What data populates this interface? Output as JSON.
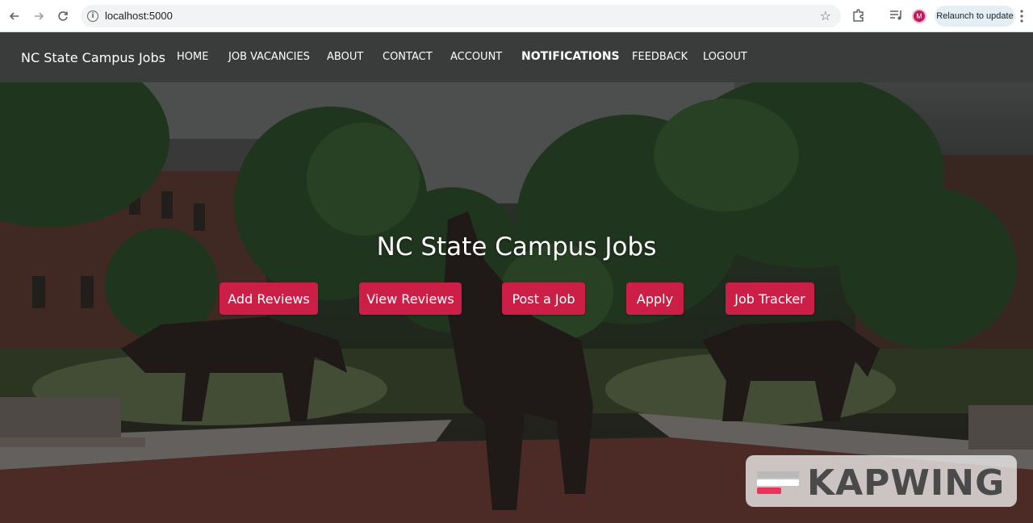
{
  "browser": {
    "url": "localhost:5000",
    "relaunch_label": "Relaunch to update",
    "profile_initial": "M",
    "icons": {
      "back": "arrow-left-icon",
      "forward": "arrow-right-icon",
      "reload": "reload-icon",
      "info": "info-icon",
      "bookmark": "star-icon",
      "extensions": "puzzle-icon",
      "media": "media-queue-icon",
      "menu": "kebab-menu-icon"
    }
  },
  "navbar": {
    "brand": "NC State Campus Jobs",
    "links": [
      {
        "label": "HOME",
        "active": false
      },
      {
        "label": "JOB VACANCIES",
        "active": false
      },
      {
        "label": "ABOUT",
        "active": false
      },
      {
        "label": "CONTACT",
        "active": false
      },
      {
        "label": "ACCOUNT",
        "active": false
      },
      {
        "label": "NOTIFICATIONS",
        "active": true
      },
      {
        "label": "FEEDBACK",
        "active": false
      },
      {
        "label": "LOGOUT",
        "active": false
      }
    ]
  },
  "hero": {
    "title": "NC State Campus Jobs",
    "buttons": [
      {
        "label": "Add Reviews"
      },
      {
        "label": "View Reviews"
      },
      {
        "label": "Post a Job"
      },
      {
        "label": "Apply"
      },
      {
        "label": "Job Tracker"
      }
    ],
    "button_color": "#cc1f48"
  },
  "watermark": {
    "text": "KAPWING"
  },
  "colors": {
    "navbar_bg": "#3a3b3b",
    "accent": "#cc1f48"
  }
}
